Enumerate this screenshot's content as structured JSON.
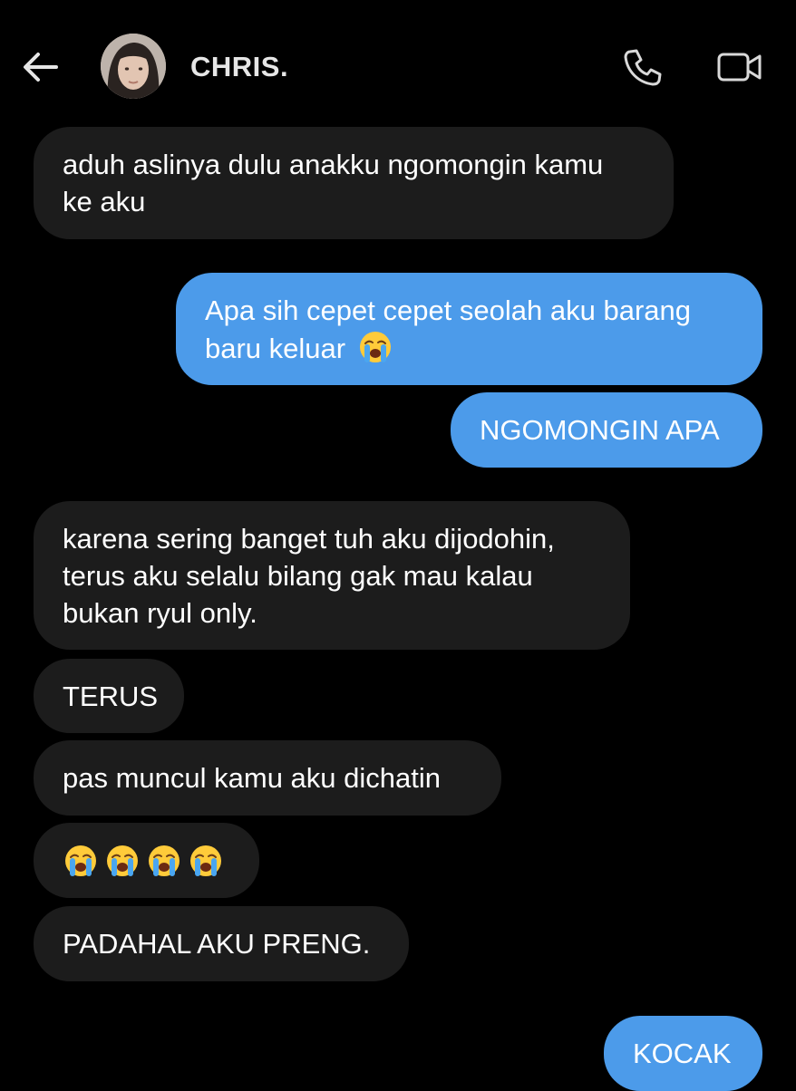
{
  "header": {
    "contact_name": "CHRIS.",
    "back_icon": "back-arrow-icon",
    "call_icon": "phone-icon",
    "video_icon": "video-camera-icon"
  },
  "colors": {
    "background": "#000000",
    "incoming_bubble": "#1c1c1c",
    "outgoing_bubble": "#4c9bea",
    "icon": "#d9d9d9"
  },
  "messages": [
    {
      "side": "in",
      "lines": [
        "aduh aslinya dulu anakku ngomongin kamu",
        "ke aku"
      ]
    },
    {
      "side": "out",
      "lines": [
        "Apa sih cepet cepet seolah aku barang",
        "baru keluar"
      ],
      "emoji": "loudly-crying-face"
    },
    {
      "side": "out",
      "lines": [
        "NGOMONGIN APA"
      ]
    },
    {
      "side": "in",
      "lines": [
        "karena sering banget tuh aku dijodohin,",
        "terus aku selalu bilang gak mau kalau",
        "bukan ryul only."
      ]
    },
    {
      "side": "in",
      "lines": [
        "TERUS"
      ]
    },
    {
      "side": "in",
      "lines": [
        "pas muncul kamu aku dichatin"
      ]
    },
    {
      "side": "in",
      "emojis": [
        "loudly-crying-face",
        "loudly-crying-face",
        "loudly-crying-face",
        "loudly-crying-face"
      ]
    },
    {
      "side": "in",
      "lines": [
        "PADAHAL AKU PRENG."
      ]
    },
    {
      "side": "out",
      "lines": [
        "KOCAK"
      ]
    }
  ]
}
